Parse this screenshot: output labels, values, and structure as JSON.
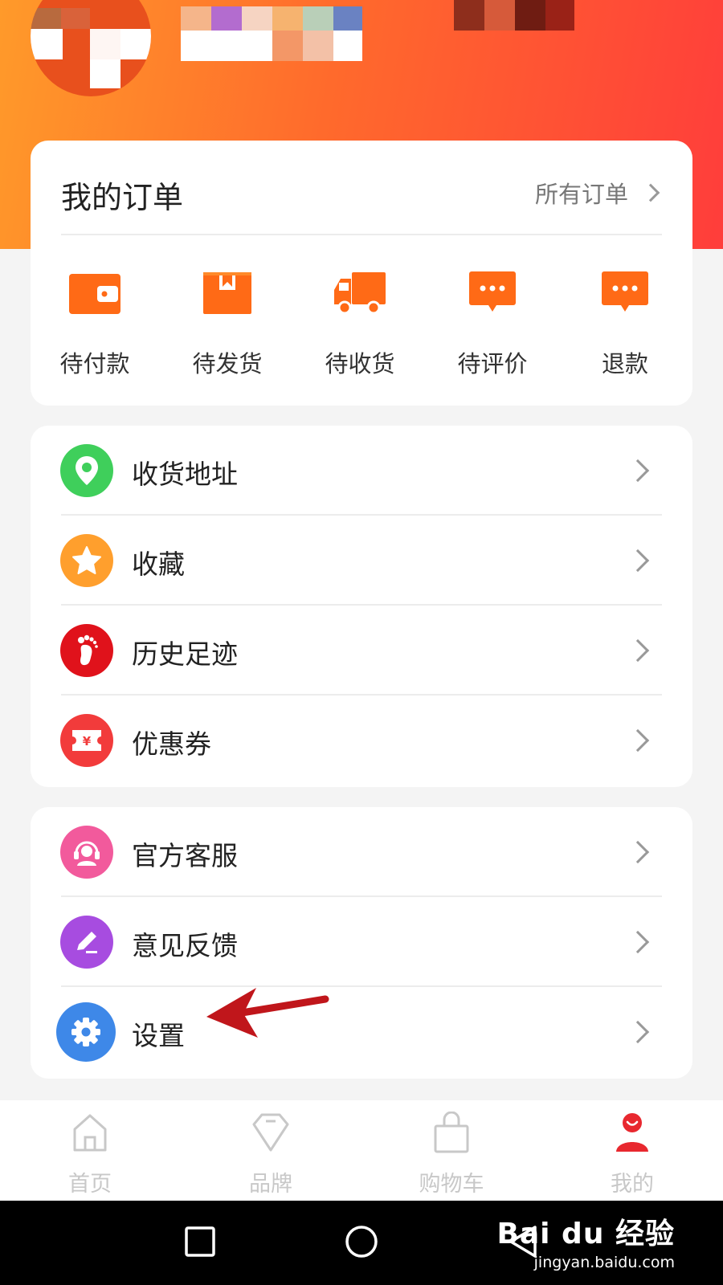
{
  "orders": {
    "title": "我的订单",
    "all_orders_label": "所有订单",
    "items": [
      {
        "label": "待付款",
        "icon": "wallet-icon"
      },
      {
        "label": "待发货",
        "icon": "package-icon"
      },
      {
        "label": "待收货",
        "icon": "truck-icon"
      },
      {
        "label": "待评价",
        "icon": "comment-icon"
      },
      {
        "label": "退款",
        "icon": "refund-icon"
      }
    ]
  },
  "menu1": [
    {
      "label": "收货地址",
      "icon": "location-pin-icon",
      "color": "#3fcf5b"
    },
    {
      "label": "收藏",
      "icon": "star-icon",
      "color": "#ff9f2d"
    },
    {
      "label": "历史足迹",
      "icon": "footprint-icon",
      "color": "#e0121b"
    },
    {
      "label": "优惠券",
      "icon": "coupon-icon",
      "color": "#f23b3b"
    }
  ],
  "menu2": [
    {
      "label": "官方客服",
      "icon": "headset-icon",
      "color": "#f25a9c"
    },
    {
      "label": "意见反馈",
      "icon": "edit-icon",
      "color": "#a74ce0"
    },
    {
      "label": "设置",
      "icon": "gear-icon",
      "color": "#3e88e8"
    }
  ],
  "coupon_symbol": "¥",
  "tabs": [
    {
      "label": "首页",
      "icon": "home-icon"
    },
    {
      "label": "品牌",
      "icon": "diamond-icon"
    },
    {
      "label": "购物车",
      "icon": "shopping-bag-icon"
    },
    {
      "label": "我的",
      "icon": "user-icon",
      "active": true
    }
  ],
  "watermark": {
    "logo": "Bai du 经验",
    "url": "jingyan.baidu.com"
  },
  "colors": {
    "accent": "#ff5a2a",
    "header_start": "#ff9a2a",
    "header_end": "#ff3d3b",
    "active_tab": "#e8282f",
    "annotation_arrow": "#c0161b"
  }
}
